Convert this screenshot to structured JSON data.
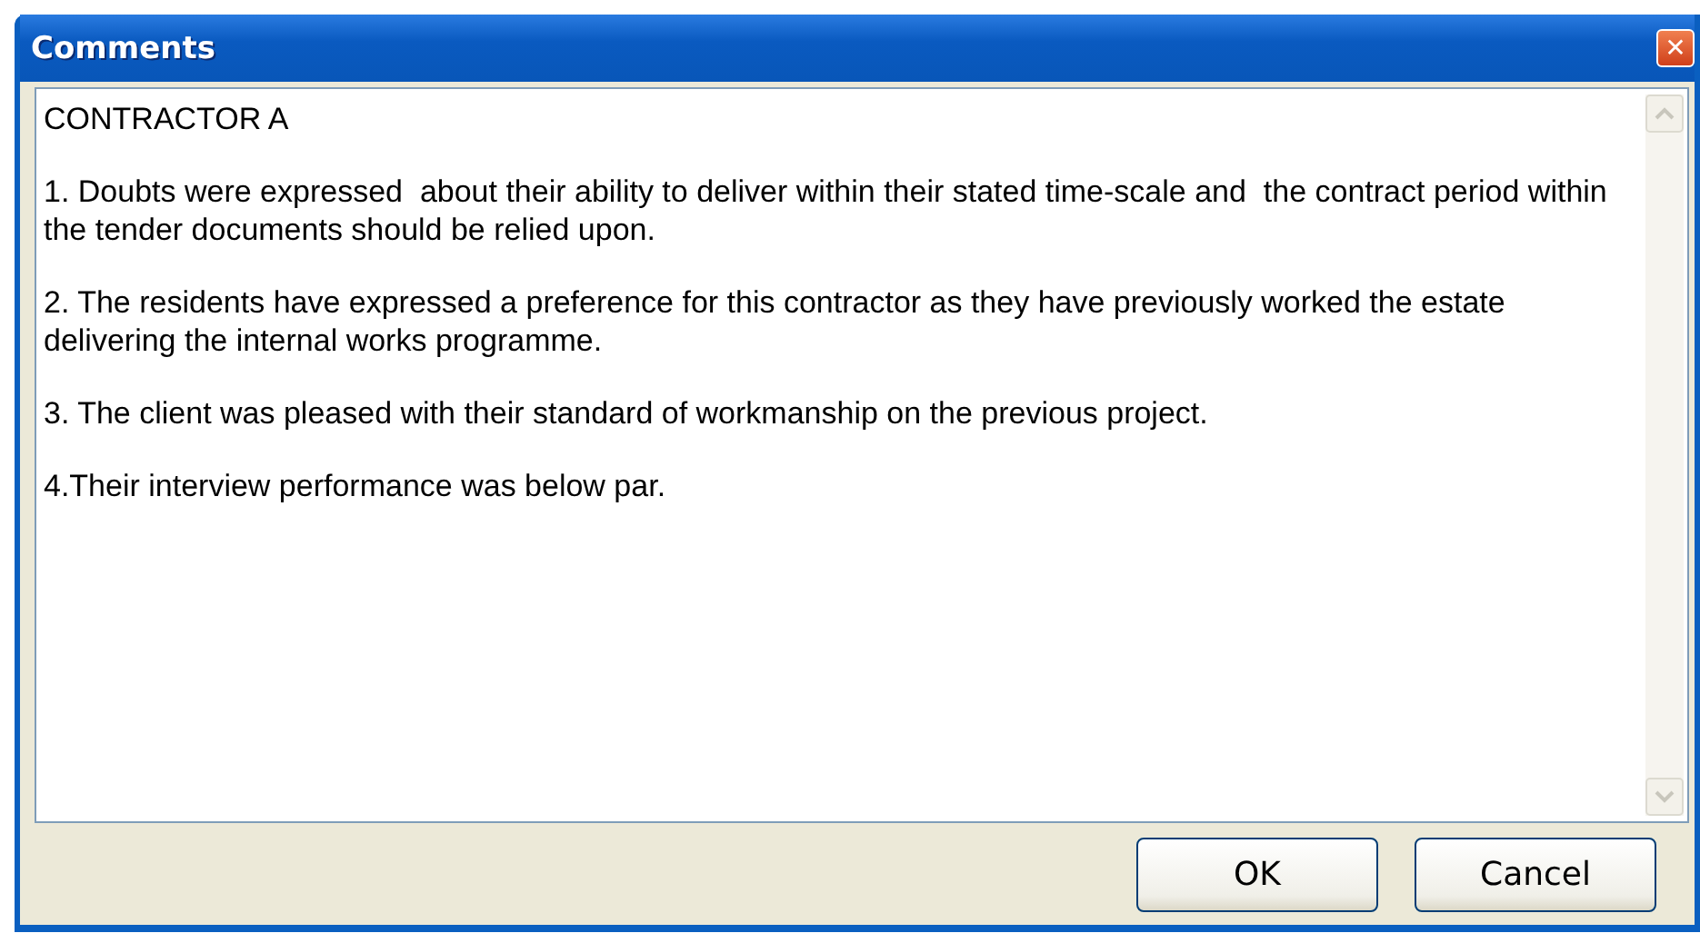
{
  "window": {
    "title": "Comments",
    "close_symbol": "✕"
  },
  "comments": {
    "paragraphs": [
      "CONTRACTOR A",
      "1. Doubts were expressed  about their ability to deliver within their stated time-scale and  the contract period within the tender documents should be relied upon.",
      "2. The residents have expressed a preference for this contractor as they have previously worked the estate delivering the internal works programme.",
      "3. The client was pleased with their standard of workmanship on the previous project.",
      "4.Their interview performance was below par."
    ]
  },
  "buttons": [
    "OK",
    "Cancel"
  ]
}
